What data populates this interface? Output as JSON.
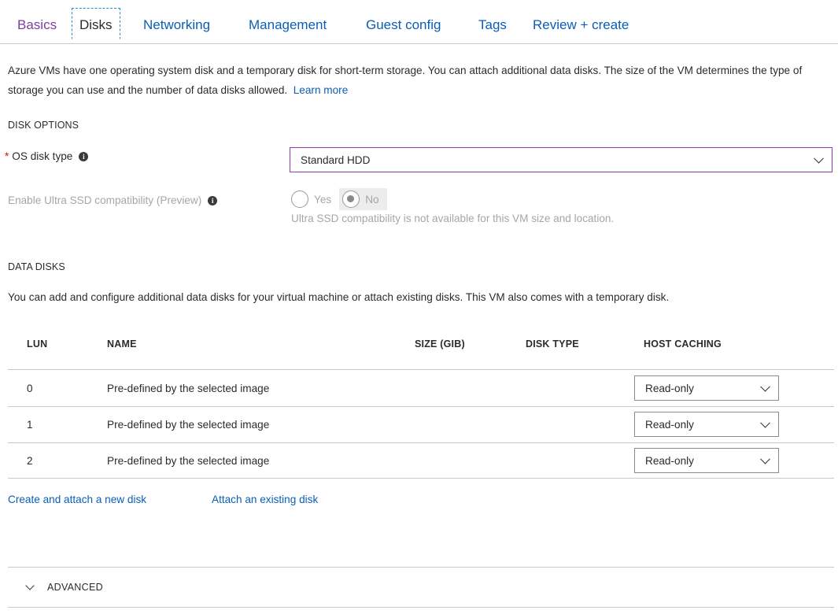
{
  "tabs": [
    {
      "label": "Basics"
    },
    {
      "label": "Disks"
    },
    {
      "label": "Networking"
    },
    {
      "label": "Management"
    },
    {
      "label": "Guest config"
    },
    {
      "label": "Tags"
    },
    {
      "label": "Review + create"
    }
  ],
  "intro": {
    "text": "Azure VMs have one operating system disk and a temporary disk for short-term storage. You can attach additional data disks. The size of the VM determines the type of storage you can use and the number of data disks allowed.",
    "learn_more": "Learn more"
  },
  "disk_options": {
    "heading": "DISK OPTIONS",
    "required_mark": "*",
    "os_disk_label": "OS disk type",
    "os_disk_value": "Standard HDD",
    "ultra_label": "Enable Ultra SSD compatibility (Preview)",
    "ultra_yes": "Yes",
    "ultra_no": "No",
    "ultra_selected": "No",
    "ultra_hint": "Ultra SSD compatibility is not available for this VM size and location."
  },
  "data_disks": {
    "heading": "DATA DISKS",
    "description": "You can add and configure additional data disks for your virtual machine or attach existing disks. This VM also comes with a temporary disk.",
    "columns": {
      "lun": "LUN",
      "name": "NAME",
      "size": "SIZE (GIB)",
      "disk_type": "DISK TYPE",
      "host_caching": "HOST CACHING"
    },
    "rows": [
      {
        "lun": "0",
        "name": "Pre-defined by the selected image",
        "host_caching": "Read-only"
      },
      {
        "lun": "1",
        "name": "Pre-defined by the selected image",
        "host_caching": "Read-only"
      },
      {
        "lun": "2",
        "name": "Pre-defined by the selected image",
        "host_caching": "Read-only"
      }
    ],
    "create_link": "Create and attach a new disk",
    "attach_link": "Attach an existing disk"
  },
  "advanced": {
    "label": "ADVANCED"
  },
  "colors": {
    "link": "#0a5fb4",
    "visited": "#7a3fa3",
    "required": "#e00b1c",
    "select_border_focus": "#8b3eab",
    "focus_outline": "#1e8fd0"
  },
  "icons": {
    "info": "info-icon",
    "dropdown": "chevron-down-icon",
    "expand": "chevron-down-icon"
  }
}
